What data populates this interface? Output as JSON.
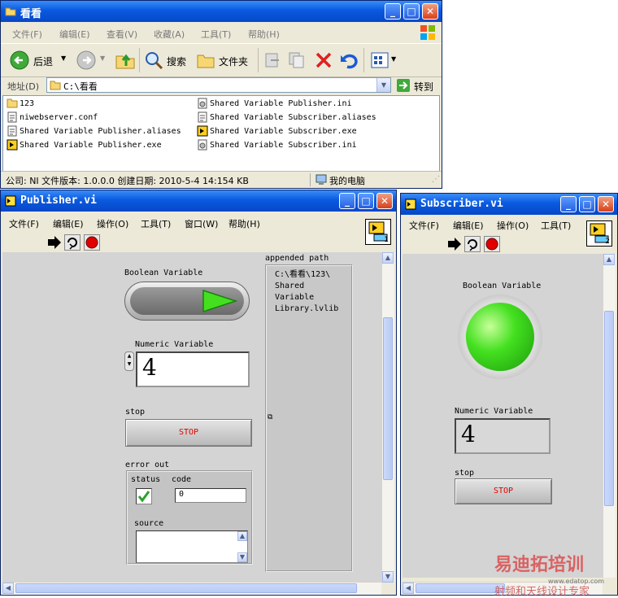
{
  "explorer": {
    "title": "看看",
    "menu": [
      "文件(F)",
      "编辑(E)",
      "查看(V)",
      "收藏(A)",
      "工具(T)",
      "帮助(H)"
    ],
    "toolbar": {
      "back": "后退",
      "search": "搜索",
      "folders": "文件夹"
    },
    "address": {
      "label": "地址(D)",
      "value": "C:\\看看",
      "go": "转到"
    },
    "files": [
      {
        "name": "123",
        "icon": "folder-icon"
      },
      {
        "name": "niwebserver.conf",
        "icon": "config-file-icon"
      },
      {
        "name": "Shared Variable Publisher.aliases",
        "icon": "config-file-icon"
      },
      {
        "name": "Shared Variable Publisher.exe",
        "icon": "labview-exe-icon"
      },
      {
        "name": "Shared Variable Publisher.ini",
        "icon": "ini-file-icon"
      },
      {
        "name": "Shared Variable Subscriber.aliases",
        "icon": "config-file-icon"
      },
      {
        "name": "Shared Variable Subscriber.exe",
        "icon": "labview-exe-icon"
      },
      {
        "name": "Shared Variable Subscriber.ini",
        "icon": "ini-file-icon"
      }
    ],
    "status": {
      "info": "公司: NI 文件版本: 1.0.0.0 创建日期: 2010-5-4 14:",
      "size": "154 KB",
      "location": "我的电脑"
    }
  },
  "publisher": {
    "title": "Publisher.vi",
    "menu": [
      "文件(F)",
      "编辑(E)",
      "操作(O)",
      "工具(T)",
      "窗口(W)",
      "帮助(H)"
    ],
    "vi_number": "1",
    "boolean_label": "Boolean Variable",
    "numeric_label": "Numeric Variable",
    "numeric_value": "4",
    "stop_label": "stop",
    "stop_text": "STOP",
    "error_out": {
      "label": "error out",
      "status_label": "status",
      "code_label": "code",
      "code_value": "0",
      "source_label": "source"
    },
    "path_label": "appended path",
    "path_lines": [
      "C:\\看看\\123\\",
      "Shared",
      "Variable",
      "Library.lvlib"
    ]
  },
  "subscriber": {
    "title": "Subscriber.vi",
    "menu": [
      "文件(F)",
      "编辑(E)",
      "操作(O)",
      "工具(T)"
    ],
    "vi_number": "2",
    "boolean_label": "Boolean Variable",
    "numeric_label": "Numeric Variable",
    "numeric_value": "4",
    "stop_label": "stop",
    "stop_text": "STOP"
  },
  "watermark": {
    "line1": "易迪拓培训",
    "line2": "射频和天线设计专家",
    "site": "www.edatop.com"
  },
  "colors": {
    "title_blue": "#0a5ae0",
    "led_green": "#44e020",
    "stop_red": "#e00000"
  }
}
